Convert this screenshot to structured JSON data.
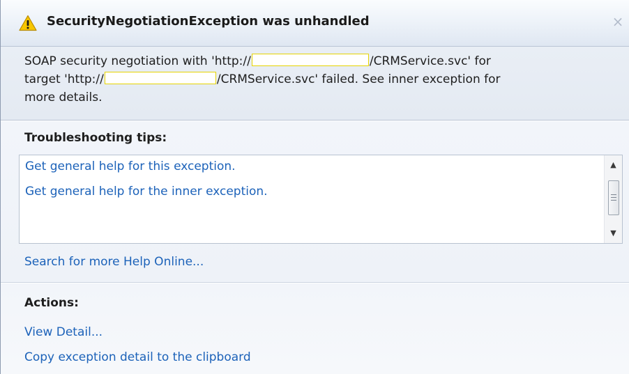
{
  "dialog": {
    "title": "SecurityNegotiationException was unhandled",
    "close_glyph": "×",
    "icons": {
      "title_icon": "warning-icon",
      "close_icon": "close-icon"
    }
  },
  "message": {
    "line1_prefix": "SOAP security negotiation with 'http://",
    "line1_suffix": "/CRMService.svc' for",
    "line2_prefix": "target 'http://",
    "line2_suffix": "/CRMService.svc' failed. See inner exception for",
    "line3": "more details."
  },
  "tips": {
    "heading": "Troubleshooting tips:",
    "items": [
      {
        "label": "Get general help for this exception."
      },
      {
        "label": "Get general help for the inner exception."
      }
    ],
    "search_link": "Search for more Help Online..."
  },
  "actions": {
    "heading": "Actions:",
    "items": [
      {
        "label": "View Detail..."
      },
      {
        "label": "Copy exception detail to the clipboard"
      }
    ]
  },
  "colors": {
    "link": "#1c62b9",
    "warning_yellow": "#f5c400",
    "redaction_border": "#e6d400"
  }
}
